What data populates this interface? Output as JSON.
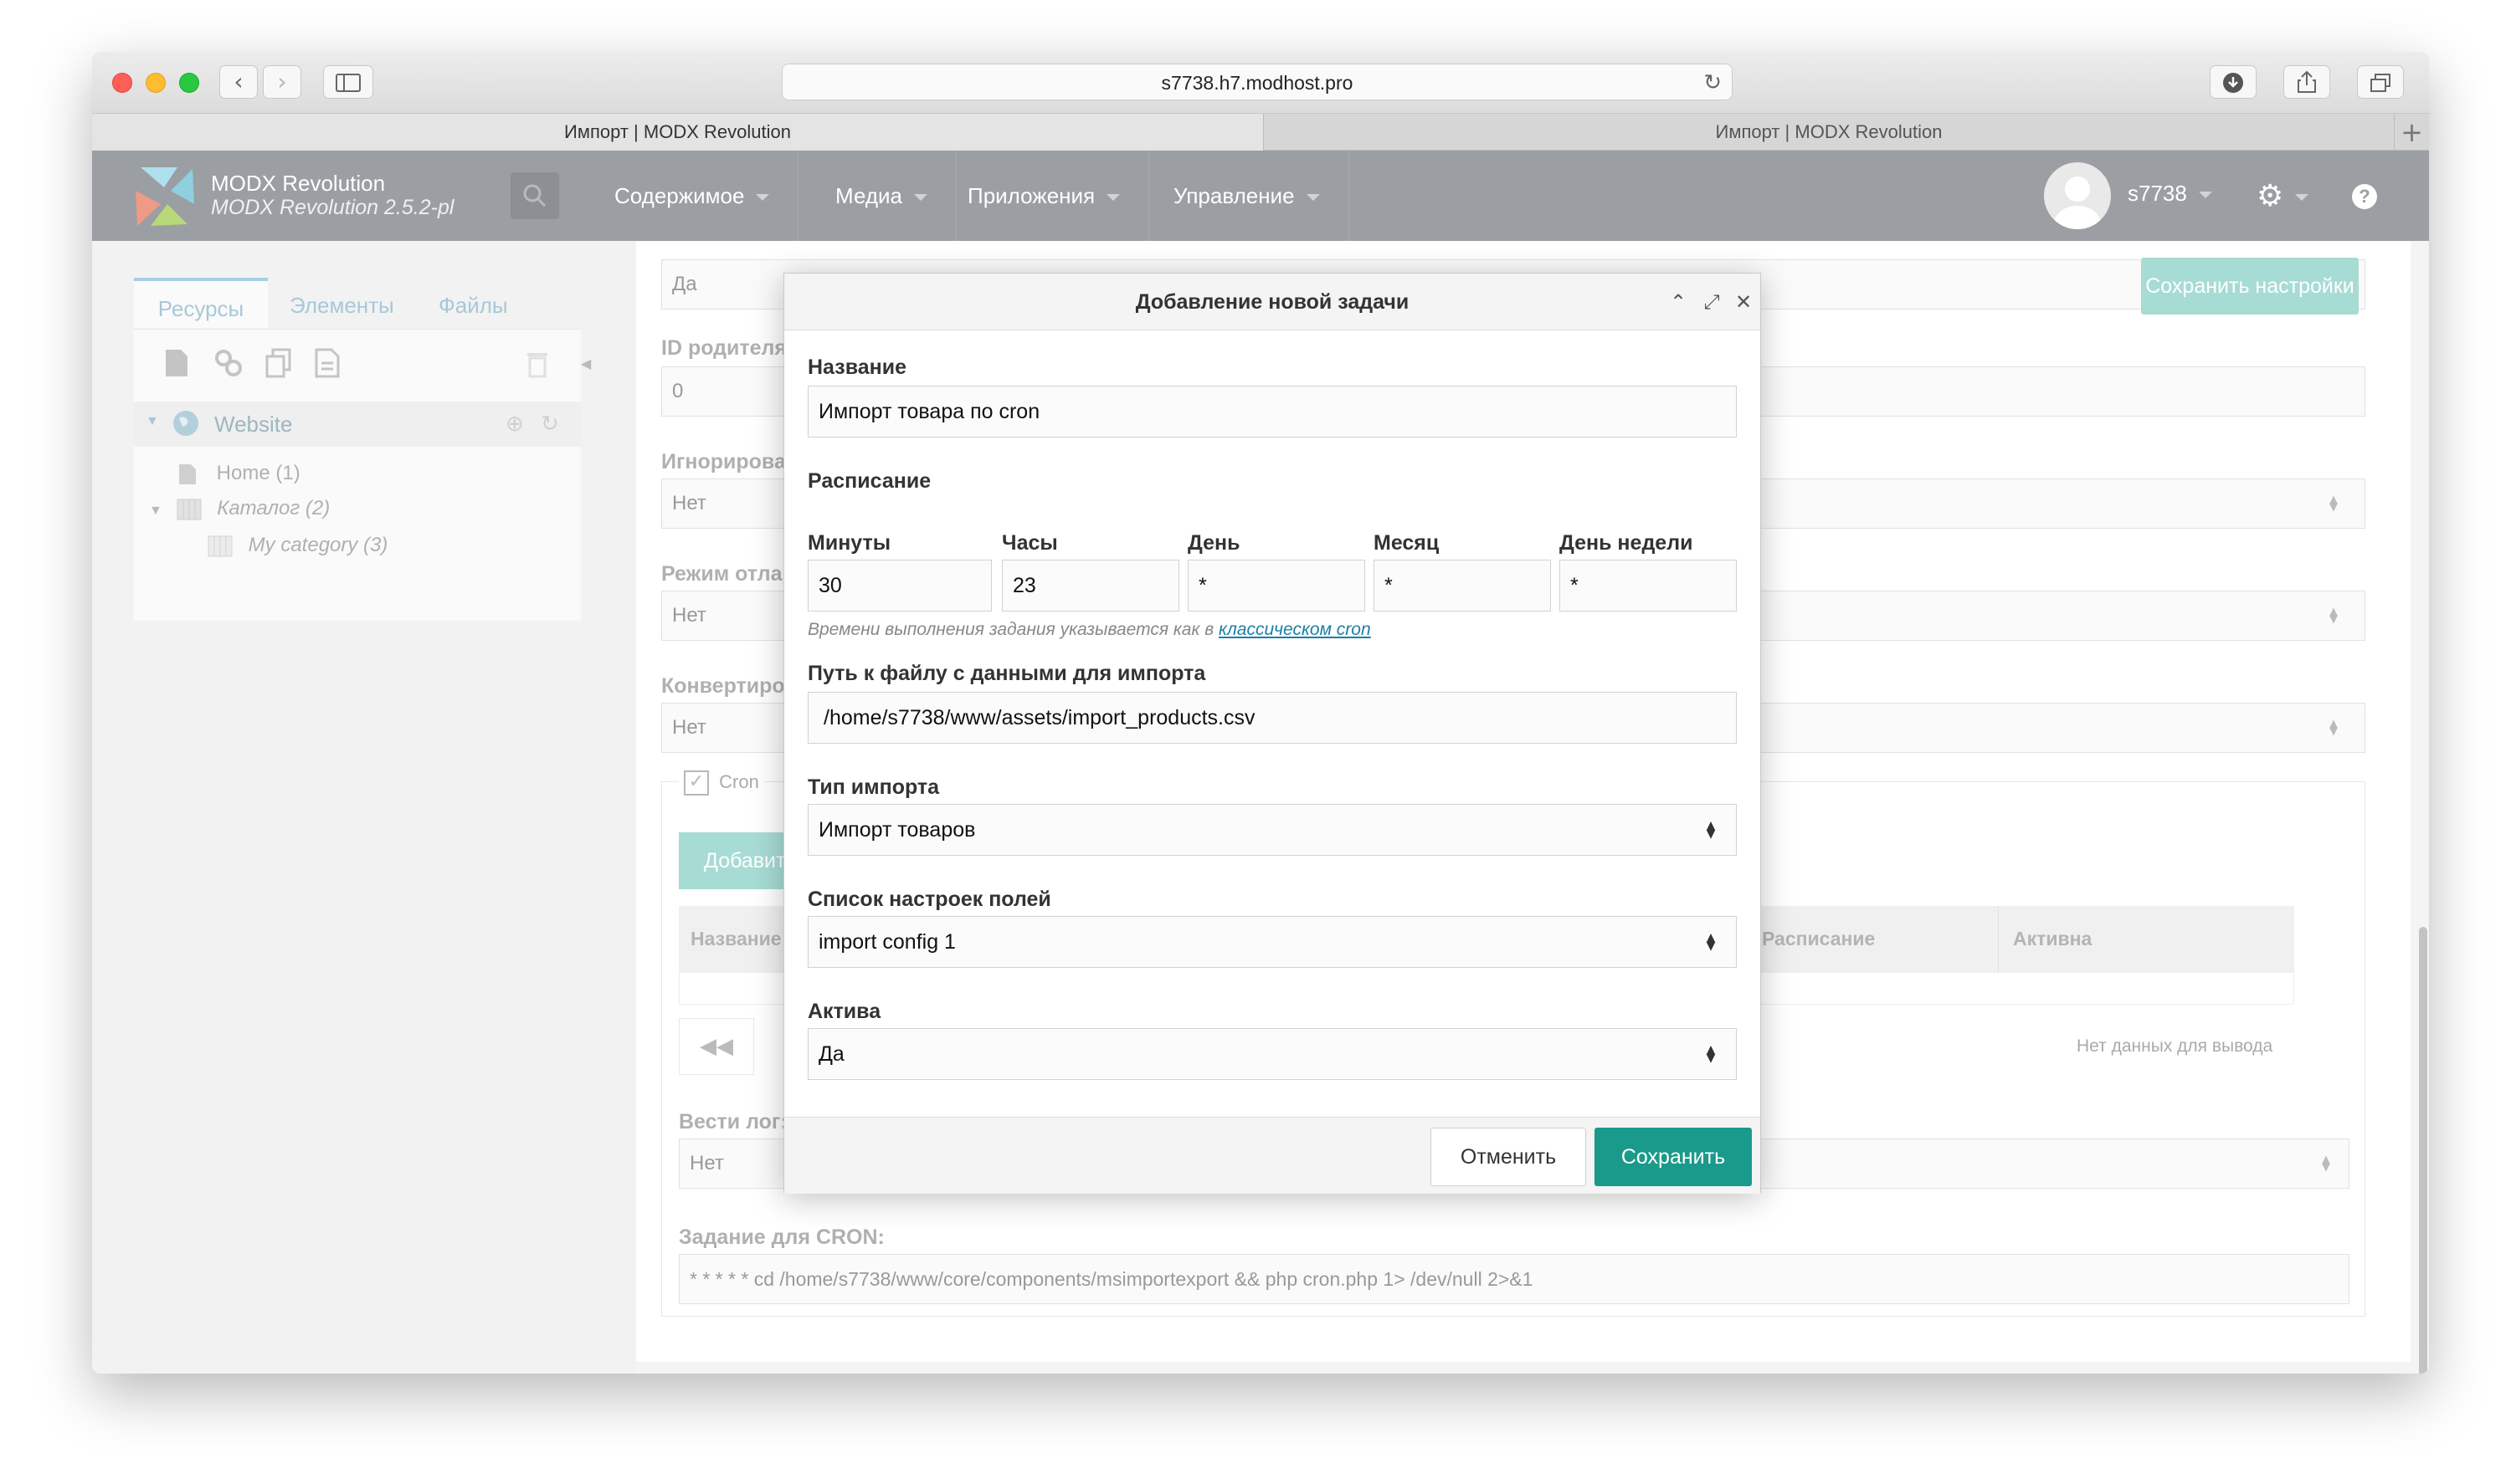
{
  "browser": {
    "url": "s7738.h7.modhost.pro",
    "tabs": [
      {
        "label": "Импорт | MODX Revolution"
      },
      {
        "label": "Импорт | MODX Revolution"
      }
    ]
  },
  "header": {
    "brand": "MODX Revolution",
    "version": "MODX Revolution 2.5.2-pl",
    "menu": [
      {
        "label": "Содержимое"
      },
      {
        "label": "Медиа"
      },
      {
        "label": "Приложения"
      },
      {
        "label": "Управление"
      }
    ],
    "username": "s7738"
  },
  "sidebar": {
    "tabs": [
      "Ресурсы",
      "Элементы",
      "Файлы"
    ],
    "tree": {
      "root": "Website",
      "items": [
        {
          "label": "Home (1)"
        },
        {
          "label": "Каталог (2)"
        },
        {
          "label": "My category (3)"
        }
      ]
    }
  },
  "settings_page": {
    "save_button": "Сохранить настройки",
    "field_top_value": "Да",
    "parent_id_label": "ID родителя",
    "parent_id_value": "0",
    "ignore_label": "Игнорирова",
    "ignore_value": "Нет",
    "debug_label": "Режим отла",
    "debug_value": "Нет",
    "convert_label": "Конвертиро",
    "convert_value": "Нет",
    "cron_checkbox": "Cron",
    "add_button": "Добавить",
    "grid": {
      "columns": [
        "Название",
        "Расписание",
        "Активна"
      ],
      "empty": "Нет данных для вывода"
    },
    "log_label": "Вести лог:",
    "log_value": "Нет",
    "cron_task_label": "Задание для CRON:",
    "cron_task_value": "* * * * * cd /home/s7738/www/core/components/msimportexport && php cron.php 1> /dev/null 2>&1"
  },
  "dialog": {
    "title": "Добавление новой задачи",
    "name_label": "Название",
    "name_value": "Импорт товара по cron",
    "schedule_label": "Расписание",
    "schedule": {
      "minutes_label": "Минуты",
      "minutes_value": "30",
      "hours_label": "Часы",
      "hours_value": "23",
      "day_label": "День",
      "day_value": "*",
      "month_label": "Месяц",
      "month_value": "*",
      "weekday_label": "День недели",
      "weekday_value": "*"
    },
    "hint_text": "Времени выполнения задания указывается как в",
    "hint_link": "классическом cron",
    "path_label": "Путь к файлу с данными для импорта",
    "path_value": "/home/s7738/www/assets/import_products.csv",
    "type_label": "Тип импорта",
    "type_value": "Импорт товаров",
    "config_label": "Список настроек полей",
    "config_value": "import config 1",
    "active_label": "Актива",
    "active_value": "Да",
    "cancel_label": "Отменить",
    "save_label": "Сохранить"
  }
}
